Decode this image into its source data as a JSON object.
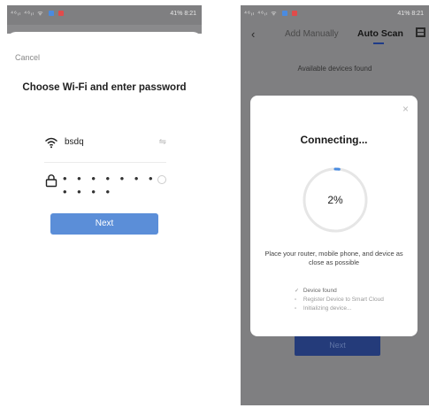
{
  "left_screen": {
    "status_bar": {
      "left": "⁴⁶ᵢₗ ⁴⁶ᵢₗ ᯤ",
      "right": "41%",
      "time": "8:21"
    },
    "cancel_label": "Cancel",
    "title": "Choose Wi-Fi and enter password",
    "wifi_name": "bsdq",
    "password_masked": "• • • • • • • • • • •",
    "next_label": "Next"
  },
  "right_screen": {
    "status_bar": {
      "left": "⁴⁶ᵢₗ ⁴⁶ᵢₗ ᯤ",
      "right": "41%",
      "time": "8:21"
    },
    "tabs": [
      {
        "label": "Add Manually",
        "active": false
      },
      {
        "label": "Auto Scan",
        "active": true
      }
    ],
    "available_text": "Available devices found",
    "next_label": "Next",
    "modal": {
      "close_label": "×",
      "title": "Connecting...",
      "progress_label": "2%",
      "progress_fraction": 0.02,
      "instruction": "Place your router, mobile phone, and device as close as possible",
      "steps": [
        {
          "mark": "✓",
          "label": "Device found"
        },
        {
          "mark": "▫",
          "label": "Register Device to Smart Cloud"
        },
        {
          "mark": "▫",
          "label": "Initializing device..."
        }
      ]
    }
  },
  "colors": {
    "next_button": "#5b8ed8",
    "overlay": "#7f7f81",
    "tab_underline": "#1f3c88",
    "progress_track": "#e6e6e6",
    "progress_accent": "#4a8be0"
  }
}
